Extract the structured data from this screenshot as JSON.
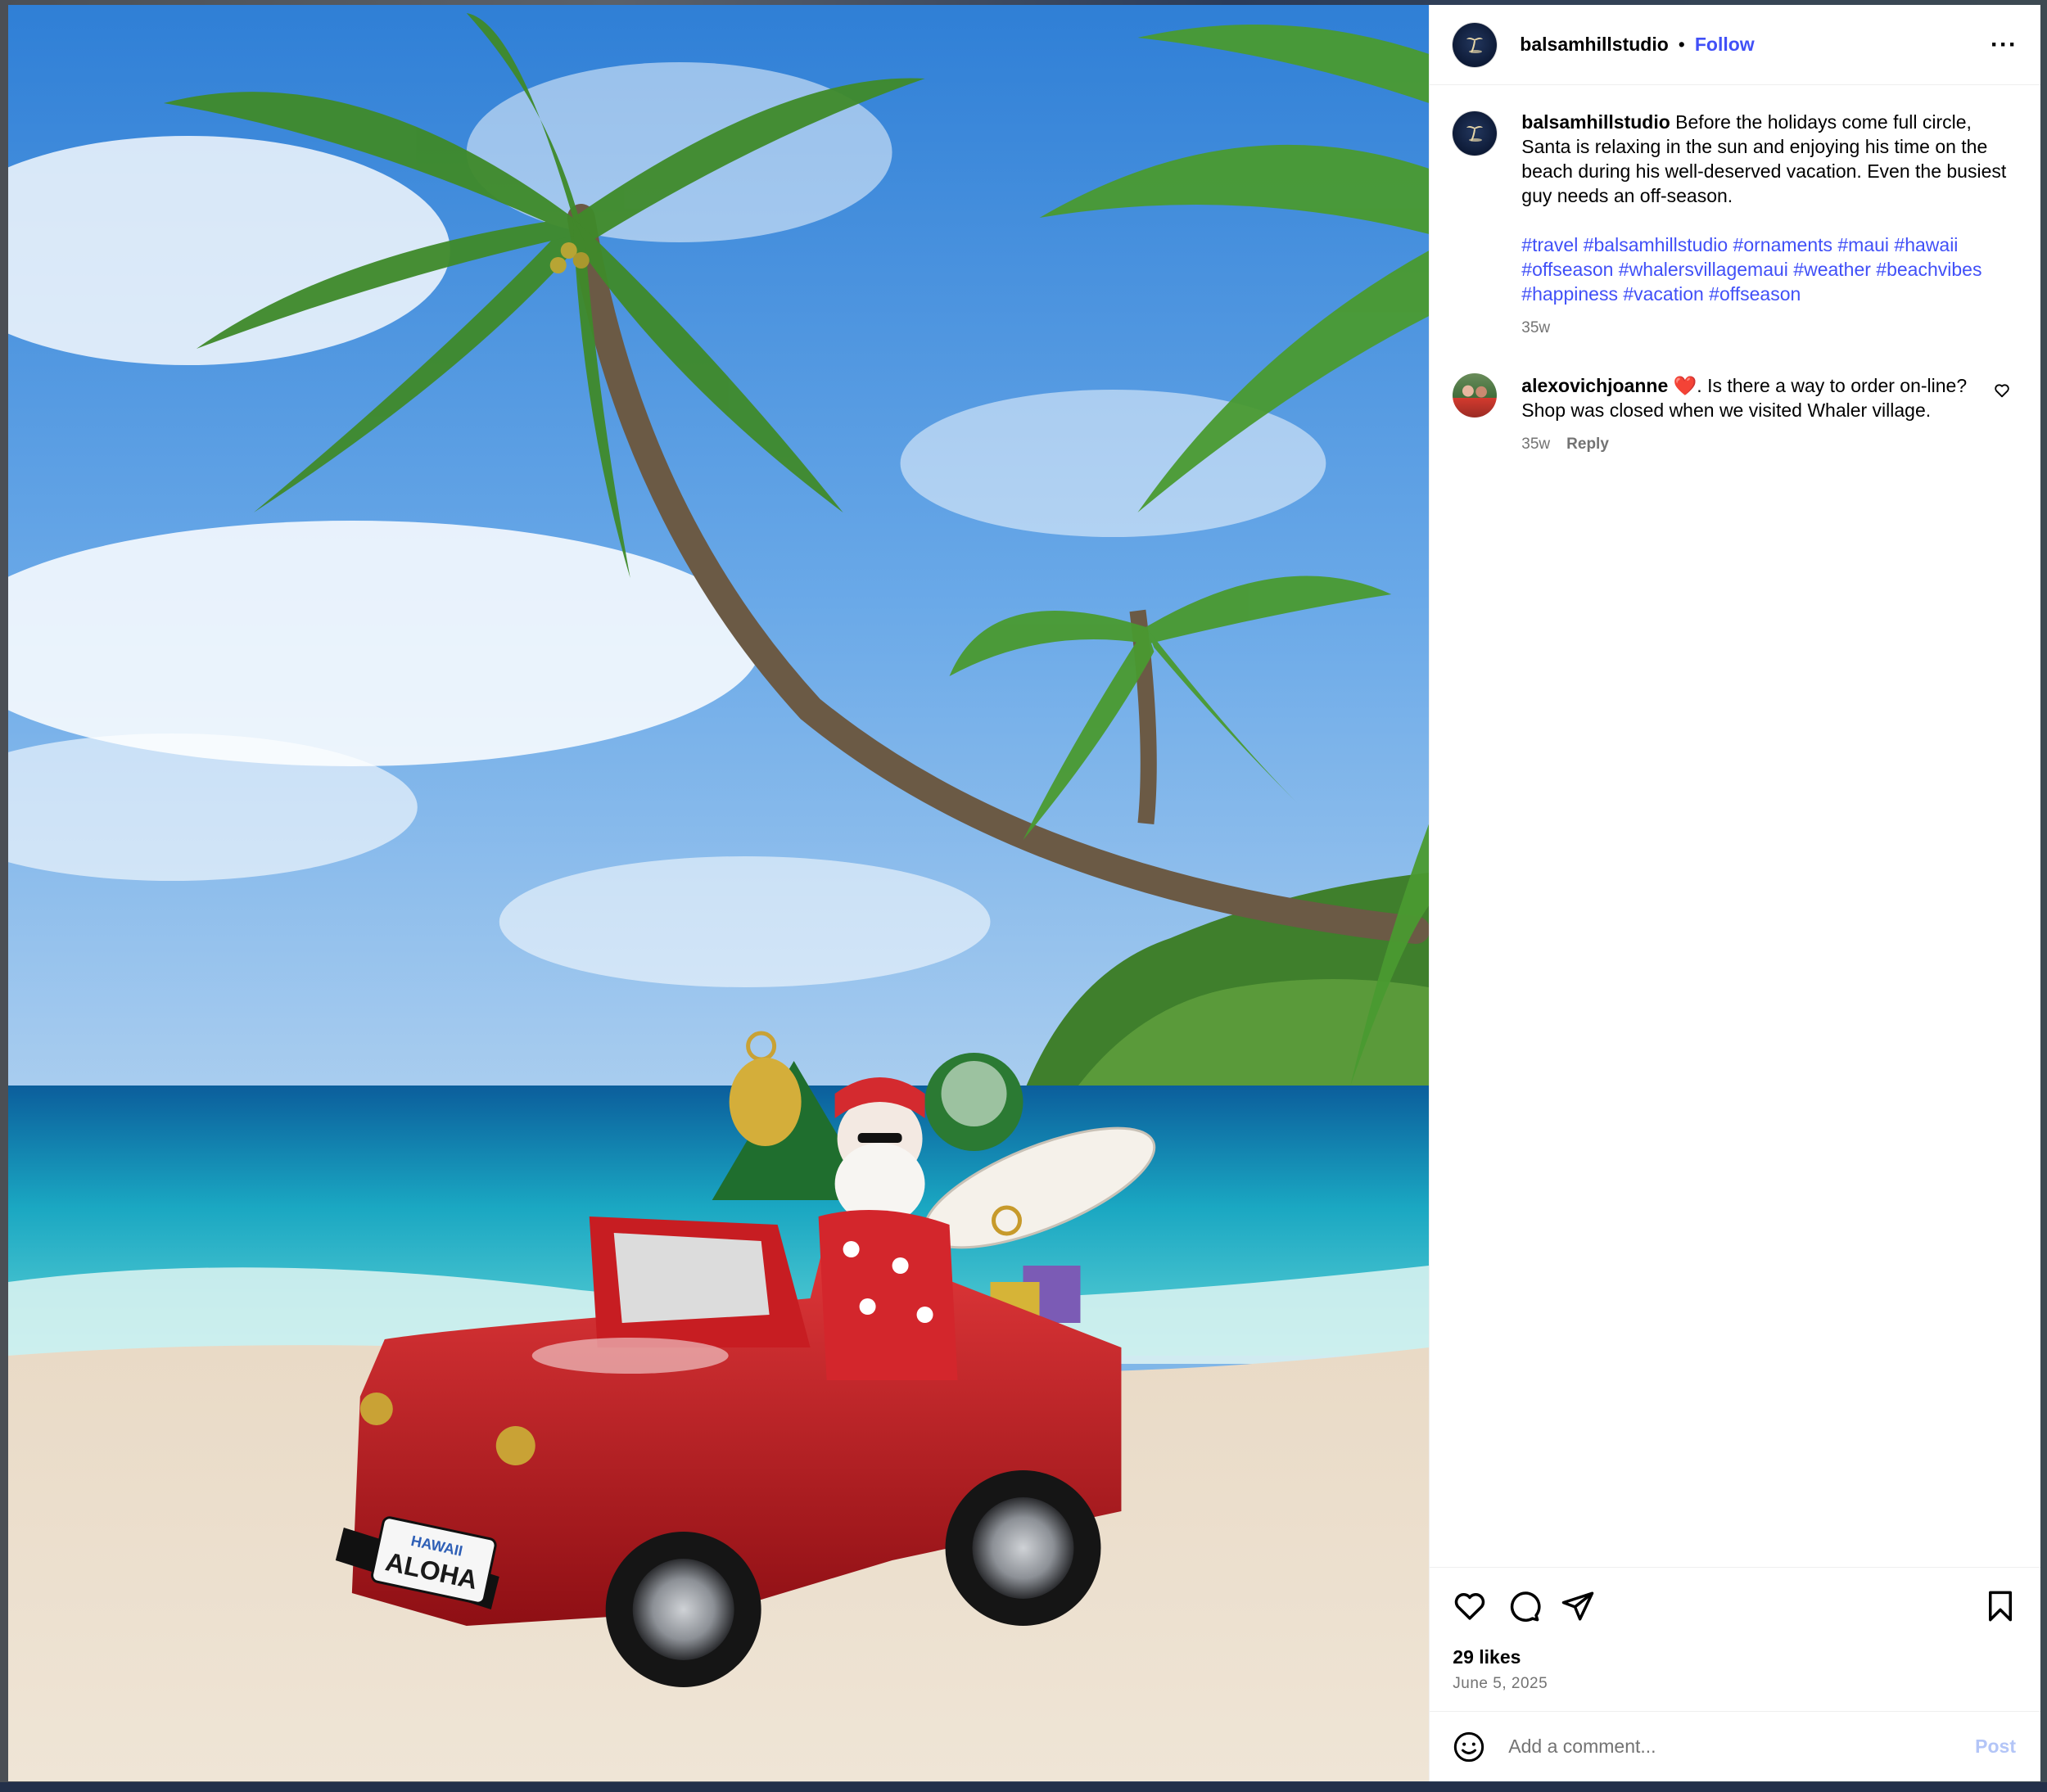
{
  "post": {
    "username": "balsamhillstudio",
    "separator": "•",
    "follow_label": "Follow",
    "more_label": "···"
  },
  "caption": {
    "username": "balsamhillstudio",
    "text": "Before the holidays come full circle, Santa is relaxing in the sun and enjoying his time on the beach during his well-deserved vacation. Even the busiest guy needs an off-season.",
    "hashtags": "#travel #balsamhillstudio #ornaments #maui #hawaii #offseason #whalersvillagemaui #weather #beachvibes #happiness #vacation #offseason",
    "age": "35w"
  },
  "comments": [
    {
      "username": "alexovichjoanne",
      "emoji": "❤️",
      "text": ". Is there a way to order on-line? Shop was closed when we visited Whaler village.",
      "age": "35w",
      "reply_label": "Reply"
    }
  ],
  "image": {
    "plate_top": "HAWAII",
    "plate_main": "ALOHA"
  },
  "stats": {
    "likes": "29 likes",
    "date": "June 5, 2025"
  },
  "composer": {
    "placeholder": "Add a comment...",
    "post_label": "Post"
  },
  "icons": {
    "avatar": "palm-logo-icon",
    "more": "more-horizontal-icon",
    "like": "heart-icon",
    "comment": "comment-bubble-icon",
    "share": "paper-plane-icon",
    "save": "bookmark-icon",
    "emoji": "smiley-icon",
    "comment_like": "heart-outline-small-icon"
  },
  "colors": {
    "link": "#4150f7",
    "muted": "#737373",
    "post_disabled": "#b3c5f7"
  }
}
